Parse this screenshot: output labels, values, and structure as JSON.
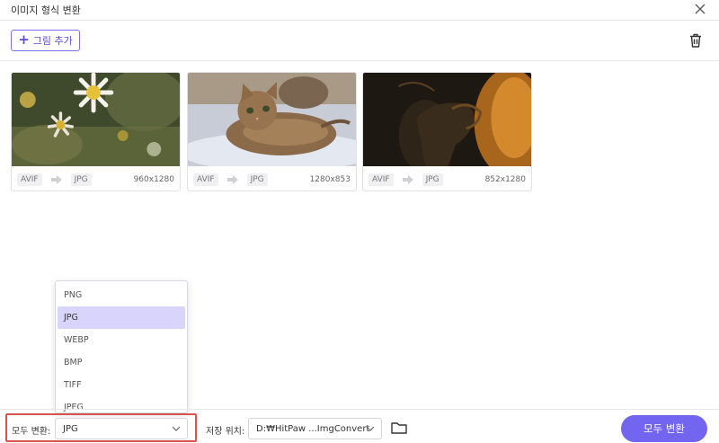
{
  "window": {
    "title": "이미지 형식 변환"
  },
  "toolbar": {
    "add_label": "그림 추가"
  },
  "images": [
    {
      "from": "AVIF",
      "to": "JPG",
      "dims": "960x1280",
      "subject": "daisies"
    },
    {
      "from": "AVIF",
      "to": "JPG",
      "dims": "1280x853",
      "subject": "kitten"
    },
    {
      "from": "AVIF",
      "to": "JPG",
      "dims": "852x1280",
      "subject": "silhouette"
    }
  ],
  "format_options": [
    "PNG",
    "JPG",
    "WEBP",
    "BMP",
    "TIFF",
    "JPEG"
  ],
  "selected_format": "JPG",
  "bottom": {
    "convert_all_label": "모두 변환:",
    "selected_value": "JPG",
    "save_label": "저장 위치:",
    "save_path": "D:₩HitPaw ...ImgConvert",
    "convert_button": "모두 변환"
  },
  "colors": {
    "accent": "#7266f0",
    "selected_option": "#d8d4fb",
    "highlight": "#d9534f"
  }
}
